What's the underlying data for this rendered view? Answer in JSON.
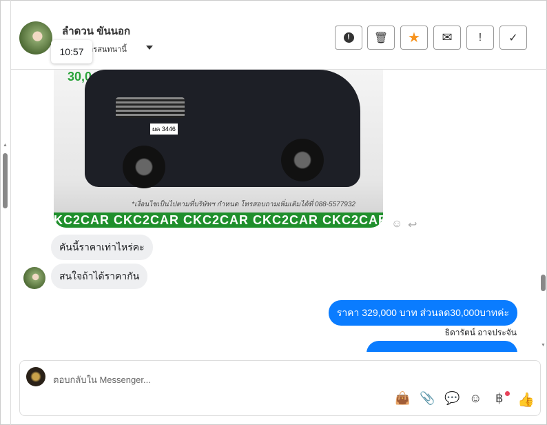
{
  "header": {
    "contact_name": "ลำดวน ขันนอก",
    "subtitle": "ยการสนทนานี้",
    "tooltip_time": "10:57",
    "actions": [
      {
        "icon": "alert-circle-icon",
        "label": "!"
      },
      {
        "icon": "trash-icon",
        "label": "🗑"
      },
      {
        "icon": "star-icon",
        "label": "★"
      },
      {
        "icon": "envelope-icon",
        "label": "✉"
      },
      {
        "icon": "exclamation-icon",
        "label": "!"
      },
      {
        "icon": "check-icon",
        "label": "✓"
      }
    ]
  },
  "image": {
    "badge": "30,0",
    "plate": "ผค 3446",
    "promo": "*เงื่อนไขเป็นไปตามที่บริษัทฯ กำหนด โทรสอบถามเพิ่มเติมได้ที่ 088-5577932",
    "banner": "KC2CAR CKC2CAR CKC2CAR CKC2CAR CKC2CAR CKC2"
  },
  "messages": {
    "in1": "คันนี้ราคาเท่าไหร่คะ",
    "in2": "สนใจถ้าได้ราคากัน",
    "out1": "ราคา 329,000 บาท ส่วนลด30,000บาทค่ะ",
    "sender": "ธิดารัตน์ อาจประจัน",
    "out2": "...."
  },
  "composer": {
    "placeholder": "ตอบกลับใน Messenger...",
    "icons": [
      "shopping-bag-icon",
      "paperclip-icon",
      "chat-bubble-icon",
      "smiley-icon",
      "baht-icon",
      "thumbs-up-icon"
    ]
  },
  "colors": {
    "accent": "#0a7cff",
    "star": "#f7931e",
    "notification": "#e8435a"
  }
}
